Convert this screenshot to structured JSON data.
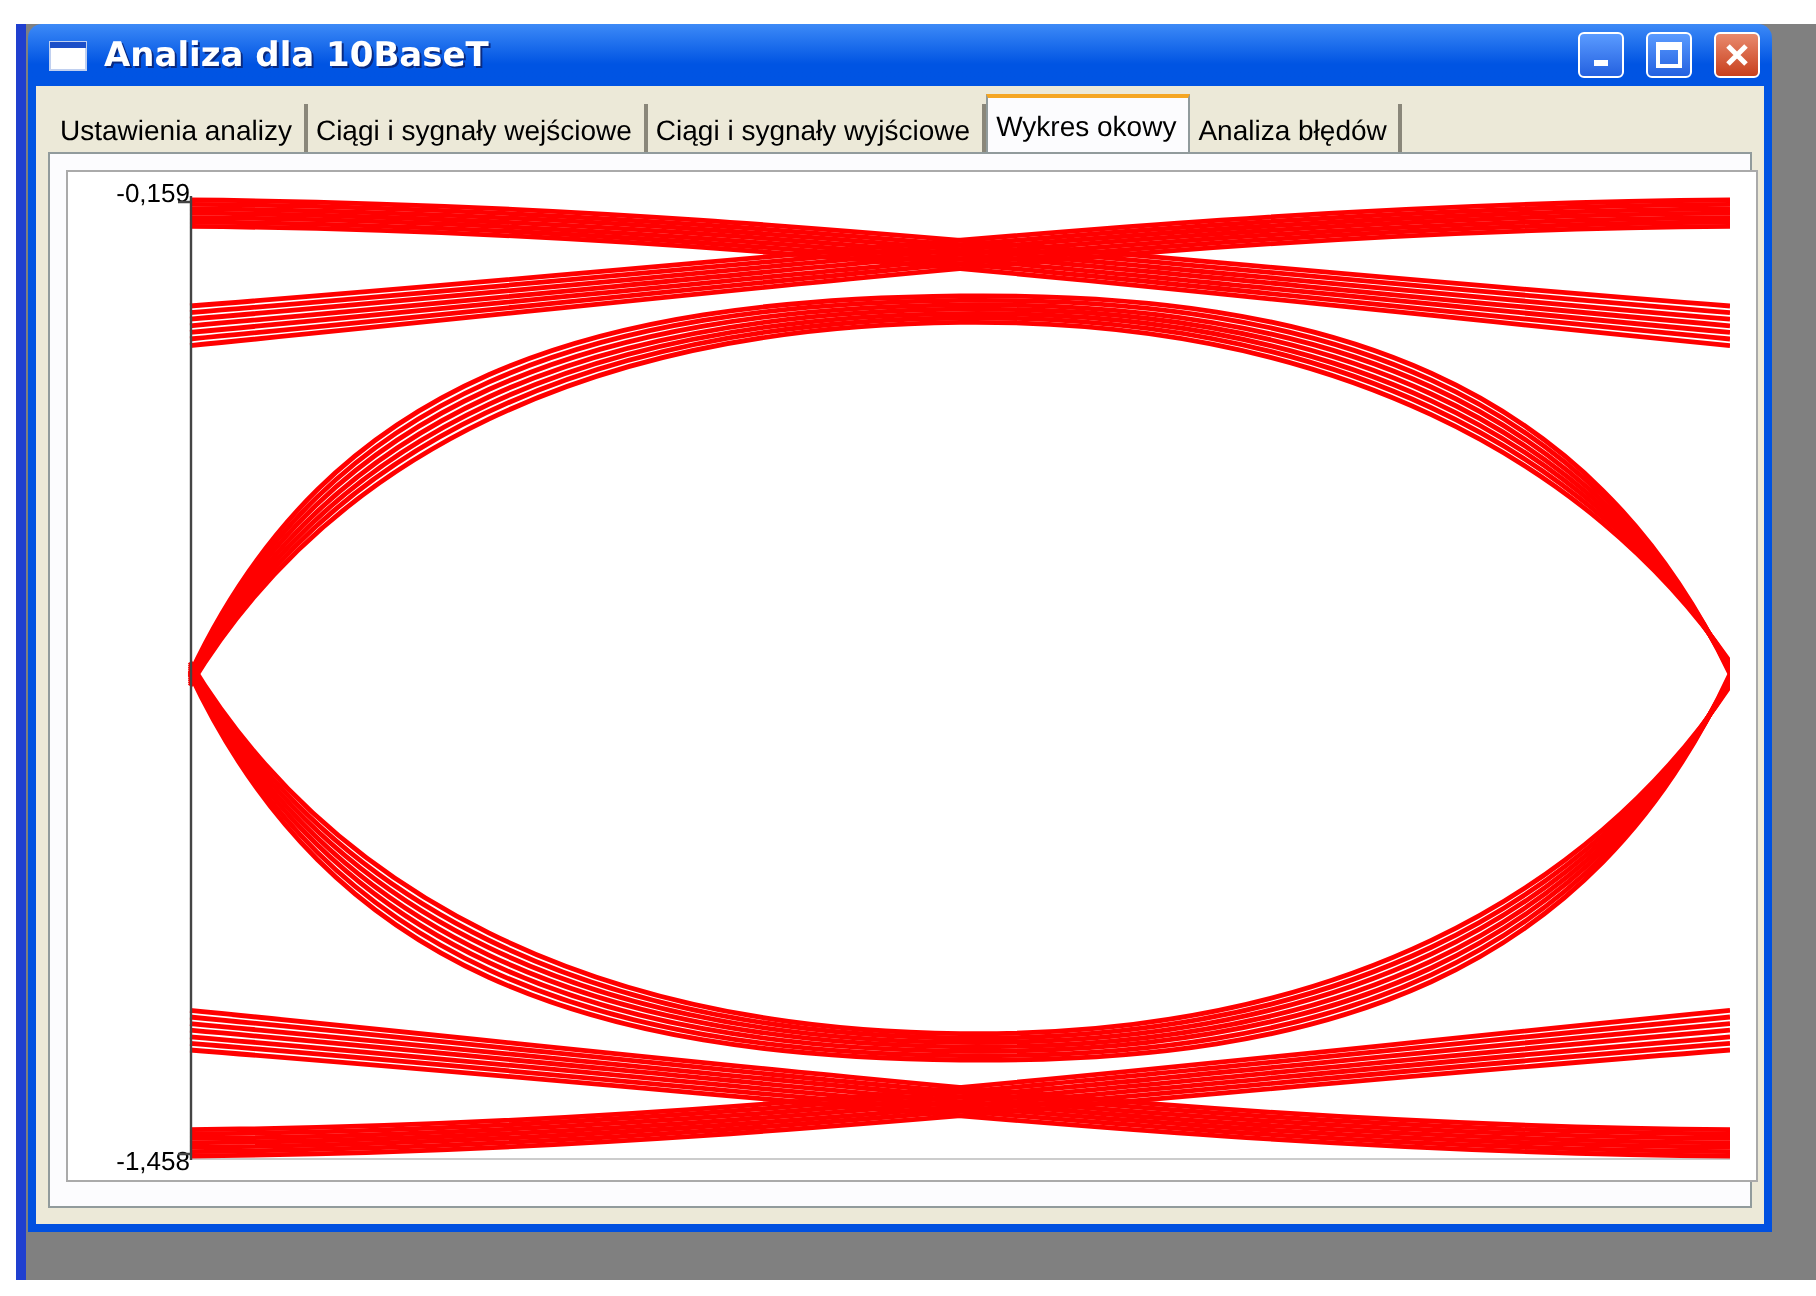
{
  "window": {
    "title": "Analiza dla 10BaseT"
  },
  "tabs": [
    {
      "label": "Ustawienia analizy",
      "selected": false
    },
    {
      "label": "Ciągi i sygnały wejściowe",
      "selected": false
    },
    {
      "label": "Ciągi i sygnały wyjściowe",
      "selected": false
    },
    {
      "label": "Wykres okowy",
      "selected": true
    },
    {
      "label": "Analiza błędów",
      "selected": false
    }
  ],
  "eye_chart": {
    "y_top_label": "-0,159",
    "y_bottom_label": "-1,458"
  }
}
